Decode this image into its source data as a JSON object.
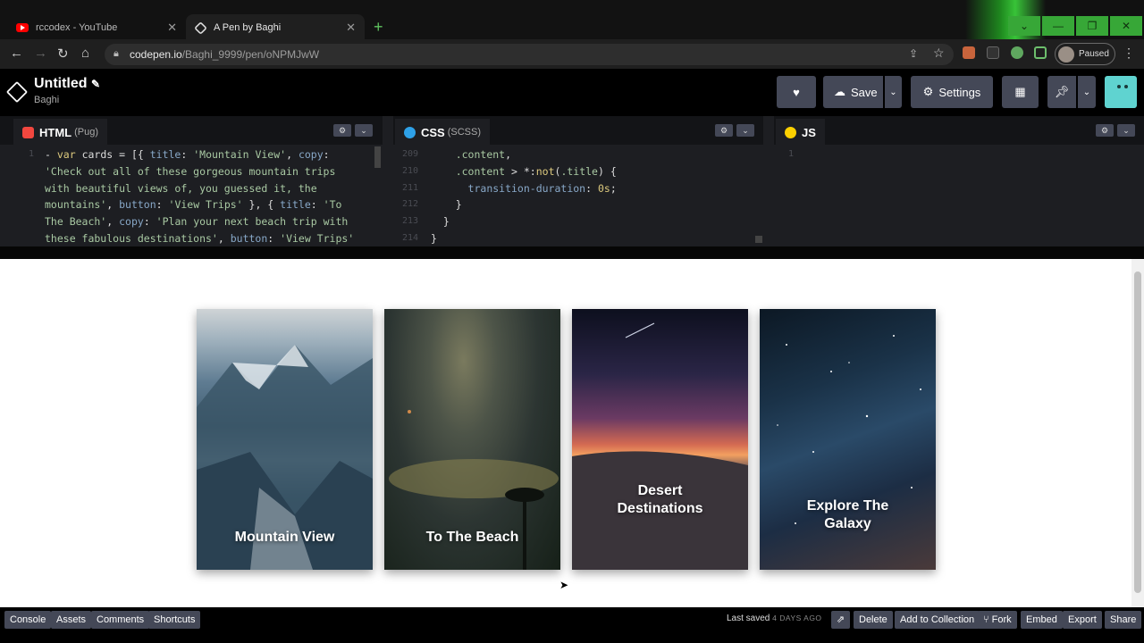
{
  "browser": {
    "tabs": [
      {
        "label": "rccodex - YouTube",
        "icon": "youtube-icon"
      },
      {
        "label": "A Pen by Baghi",
        "icon": "codepen-icon"
      }
    ],
    "url_host": "codepen.io",
    "url_path": "/Baghi_9999/pen/oNPMJwW",
    "profile_status": "Paused"
  },
  "pen": {
    "title": "Untitled",
    "author": "Baghi",
    "save_label": "Save",
    "settings_label": "Settings"
  },
  "editors": {
    "html": {
      "name": "HTML",
      "sub": "(Pug)",
      "line_numbers": [
        "1"
      ]
    },
    "css": {
      "name": "CSS",
      "sub": "(SCSS)",
      "line_numbers": [
        "209",
        "210",
        "211",
        "212",
        "213",
        "214"
      ]
    },
    "js": {
      "name": "JS",
      "line_numbers": [
        "1"
      ]
    }
  },
  "cards": [
    {
      "title": "Mountain View"
    },
    {
      "title": "To The Beach"
    },
    {
      "title": "Desert Destinations"
    },
    {
      "title": "Explore The Galaxy"
    }
  ],
  "footer": {
    "left": [
      "Console",
      "Assets",
      "Comments",
      "Shortcuts"
    ],
    "last_saved": "Last saved",
    "last_saved_when": "4 DAYS AGO",
    "right": [
      "Delete",
      "Add to Collection",
      "Fork",
      "Embed",
      "Export",
      "Share"
    ]
  },
  "colors": {
    "accent_green": "#47cf73",
    "editor_bg": "#1d1e22",
    "button_bg": "#444857"
  }
}
